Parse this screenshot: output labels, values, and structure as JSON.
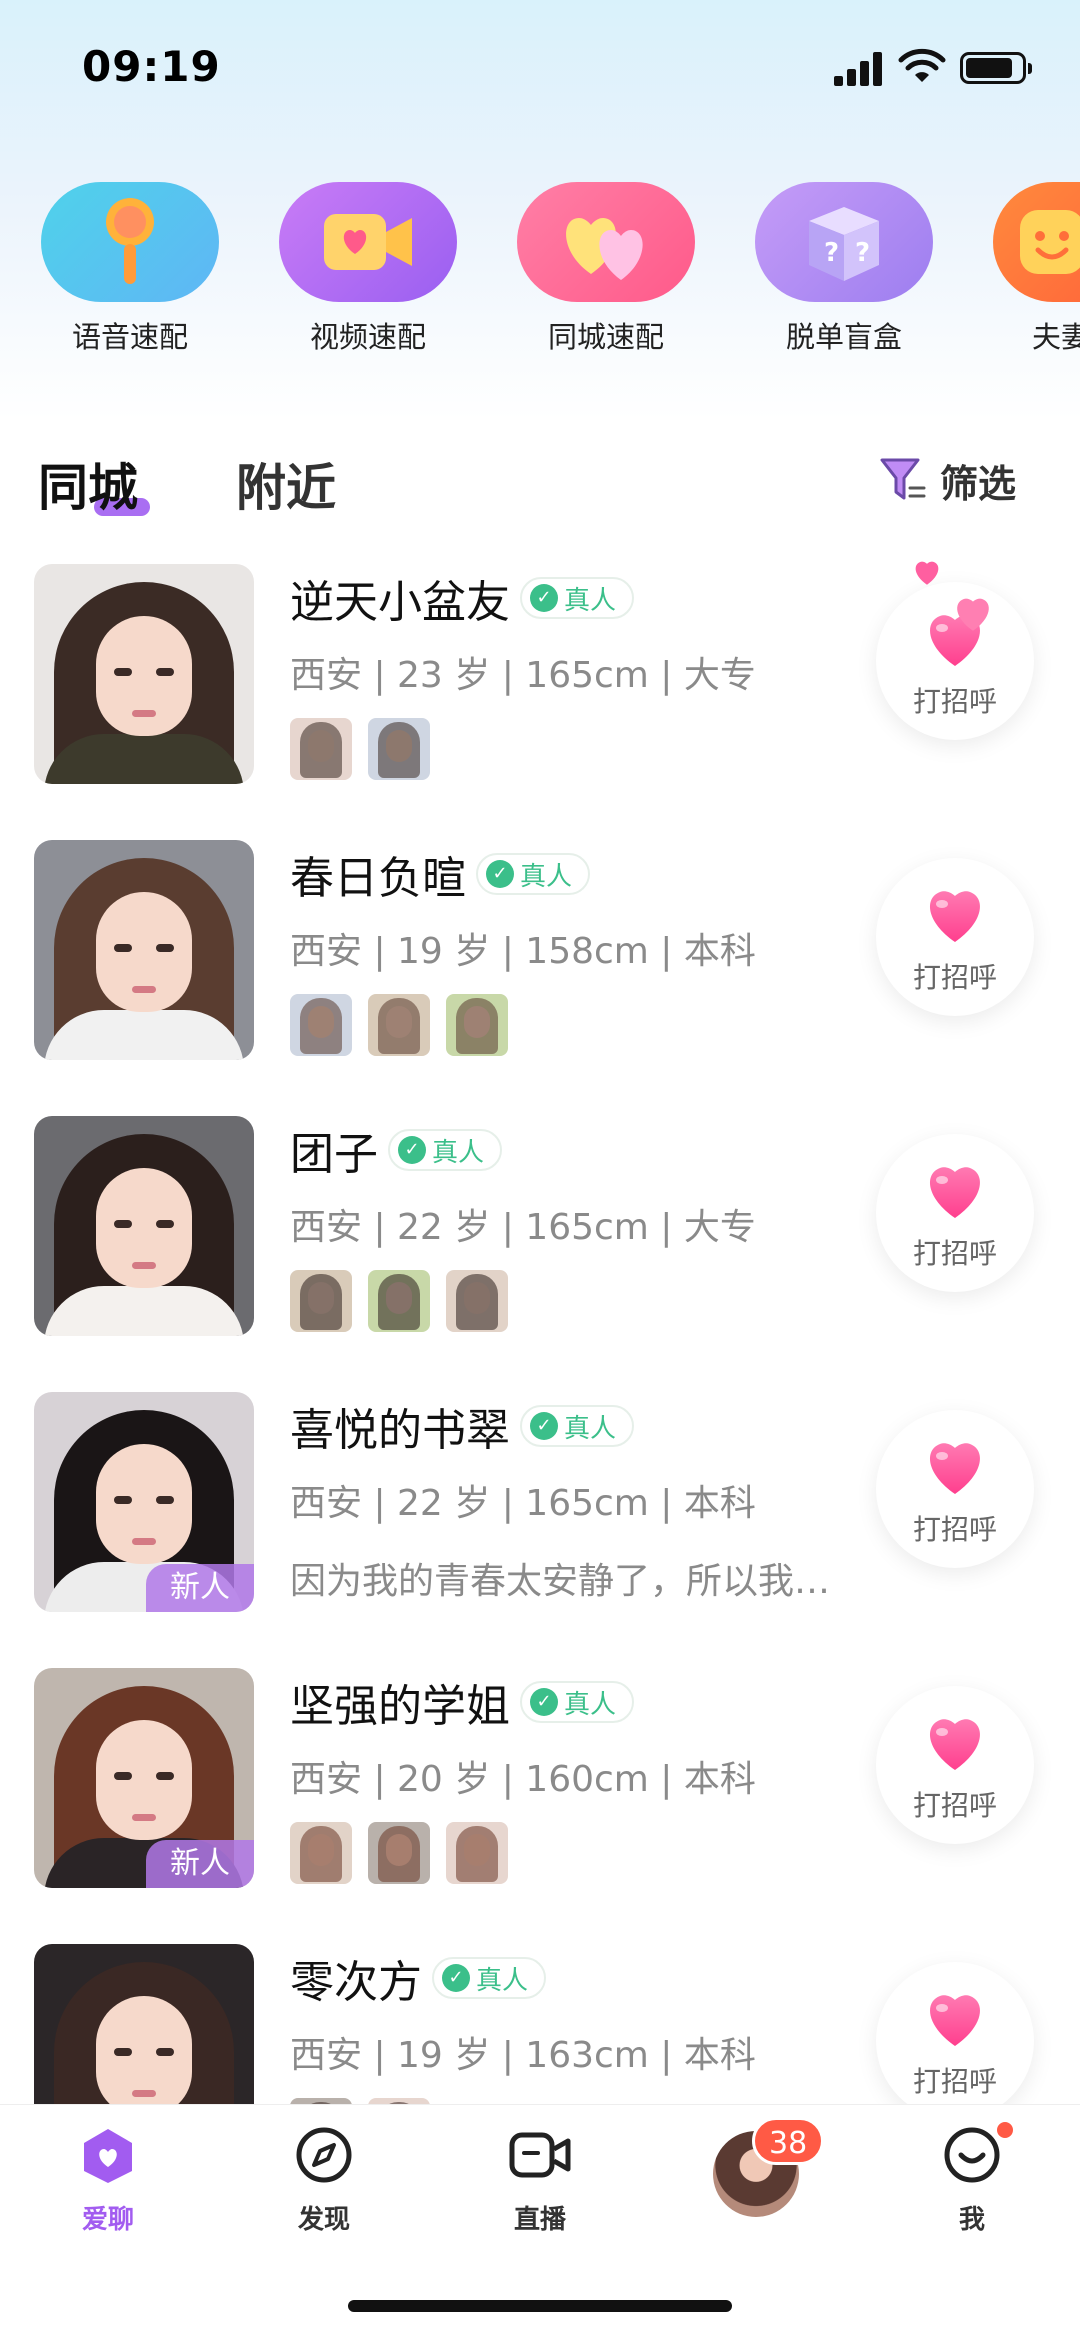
{
  "status_bar": {
    "time": "09:19"
  },
  "quick_match": [
    {
      "label": "语音速配",
      "icon": "microphone-icon"
    },
    {
      "label": "视频速配",
      "icon": "video-heart-icon"
    },
    {
      "label": "同城速配",
      "icon": "double-heart-icon"
    },
    {
      "label": "脱单盲盒",
      "icon": "mystery-box-icon"
    },
    {
      "label": "夫妻",
      "icon": "smile-face-icon"
    }
  ],
  "tabs": {
    "active": "同城",
    "inactive": "附近",
    "filter_label": "筛选"
  },
  "verified_label": "真人",
  "greet_label": "打招呼",
  "new_label": "新人",
  "users": [
    {
      "name": "逆天小盆友",
      "info": "西安 | 23 岁 | 165cm | 大专",
      "bio": "",
      "new": false,
      "photos": 2,
      "hair": "#3b2b25",
      "body": "#3d3a2c",
      "bg": "#e9e6e4"
    },
    {
      "name": "春日负暄",
      "info": "西安 | 19 岁 | 158cm | 本科",
      "bio": "",
      "new": false,
      "photos": 3,
      "hair": "#5a3d30",
      "body": "#f1f1f1",
      "bg": "#8d8f96"
    },
    {
      "name": "团子",
      "info": "西安 | 22 岁 | 165cm | 大专",
      "bio": "",
      "new": false,
      "photos": 3,
      "hair": "#2b1f1c",
      "body": "#f4f1ee",
      "bg": "#6b6b6f"
    },
    {
      "name": "喜悦的书翠",
      "info": "西安 | 22 岁 | 165cm | 本科",
      "bio": "因为我的青春太安静了，所以我…",
      "new": true,
      "photos": 0,
      "hair": "#1a1516",
      "body": "#ededed",
      "bg": "#d7d2d6"
    },
    {
      "name": "坚强的学姐",
      "info": "西安 | 20 岁 | 160cm | 本科",
      "bio": "",
      "new": true,
      "photos": 3,
      "hair": "#6a3726",
      "body": "#2a2426",
      "bg": "#bfb6ae"
    },
    {
      "name": "零次方",
      "info": "西安 | 19 岁 | 163cm | 本科",
      "bio": "",
      "new": false,
      "photos": 2,
      "hair": "#3a2824",
      "body": "#241f22",
      "bg": "#2b2628"
    }
  ],
  "bottom_nav": [
    {
      "label": "爱聊",
      "icon": "chat-heart-icon",
      "active": true
    },
    {
      "label": "发现",
      "icon": "compass-icon",
      "active": false
    },
    {
      "label": "直播",
      "icon": "live-camera-icon",
      "active": false
    },
    {
      "label": "",
      "icon": "avatar",
      "active": false
    },
    {
      "label": "我",
      "icon": "smile-icon",
      "active": false
    }
  ],
  "nav_badge_count": "38",
  "colors": {
    "accent": "#a25cf0",
    "verified": "#3bbf8a",
    "heart": "#ff4f96",
    "badge": "#ff5a45"
  }
}
